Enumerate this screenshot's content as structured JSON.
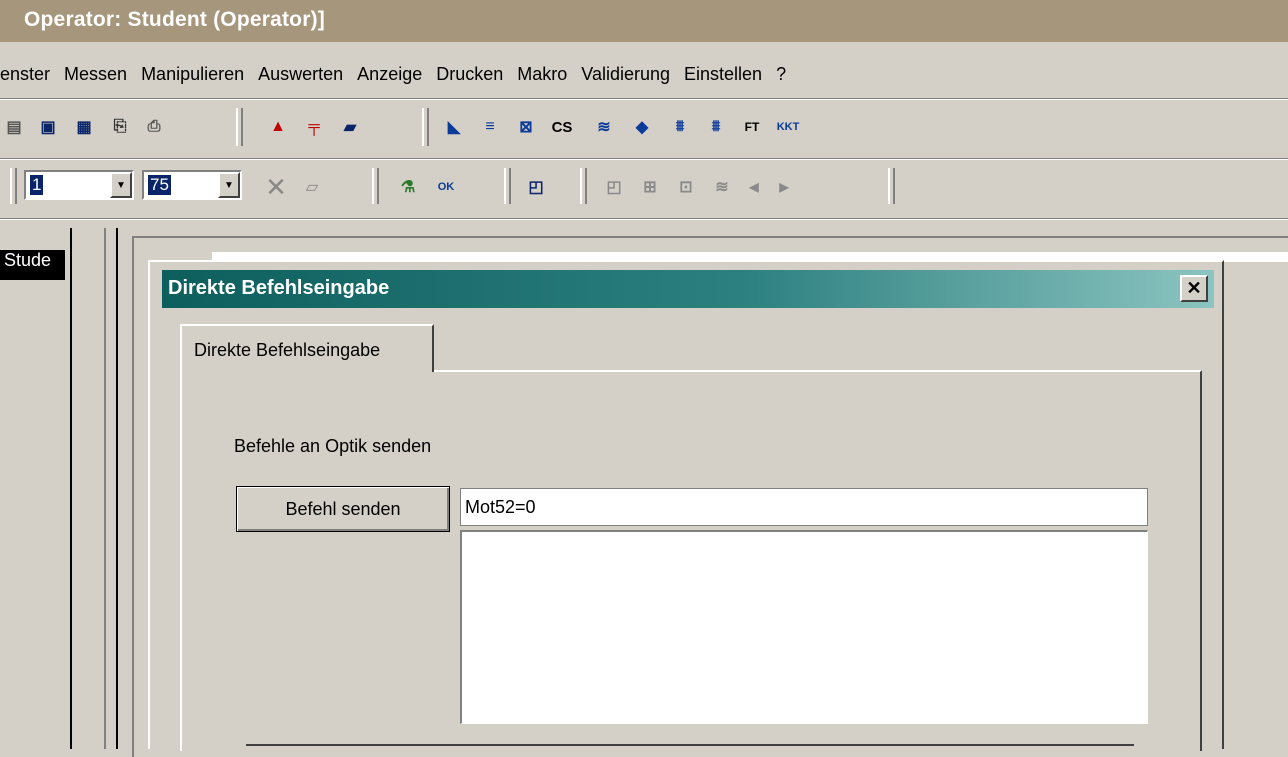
{
  "window": {
    "title": "Operator: Student  (Operator)]"
  },
  "menu": [
    "enster",
    "Messen",
    "Manipulieren",
    "Auswerten",
    "Anzeige",
    "Drucken",
    "Makro",
    "Validierung",
    "Einstellen",
    "?"
  ],
  "toolbar": {
    "combo1_value": "1",
    "combo2_value": "75",
    "cs_label": "CS",
    "ft_label": "FT",
    "kkt_label": "KKT"
  },
  "mdi": {
    "window_label": "Stude"
  },
  "dialog": {
    "title": "Direkte Befehlseingabe",
    "close": "x",
    "tab_label": "Direkte Befehlseingabe",
    "section_label": "Befehle an Optik senden",
    "send_button": "Befehl senden",
    "command_value": "Mot52=0",
    "output_text": ""
  }
}
